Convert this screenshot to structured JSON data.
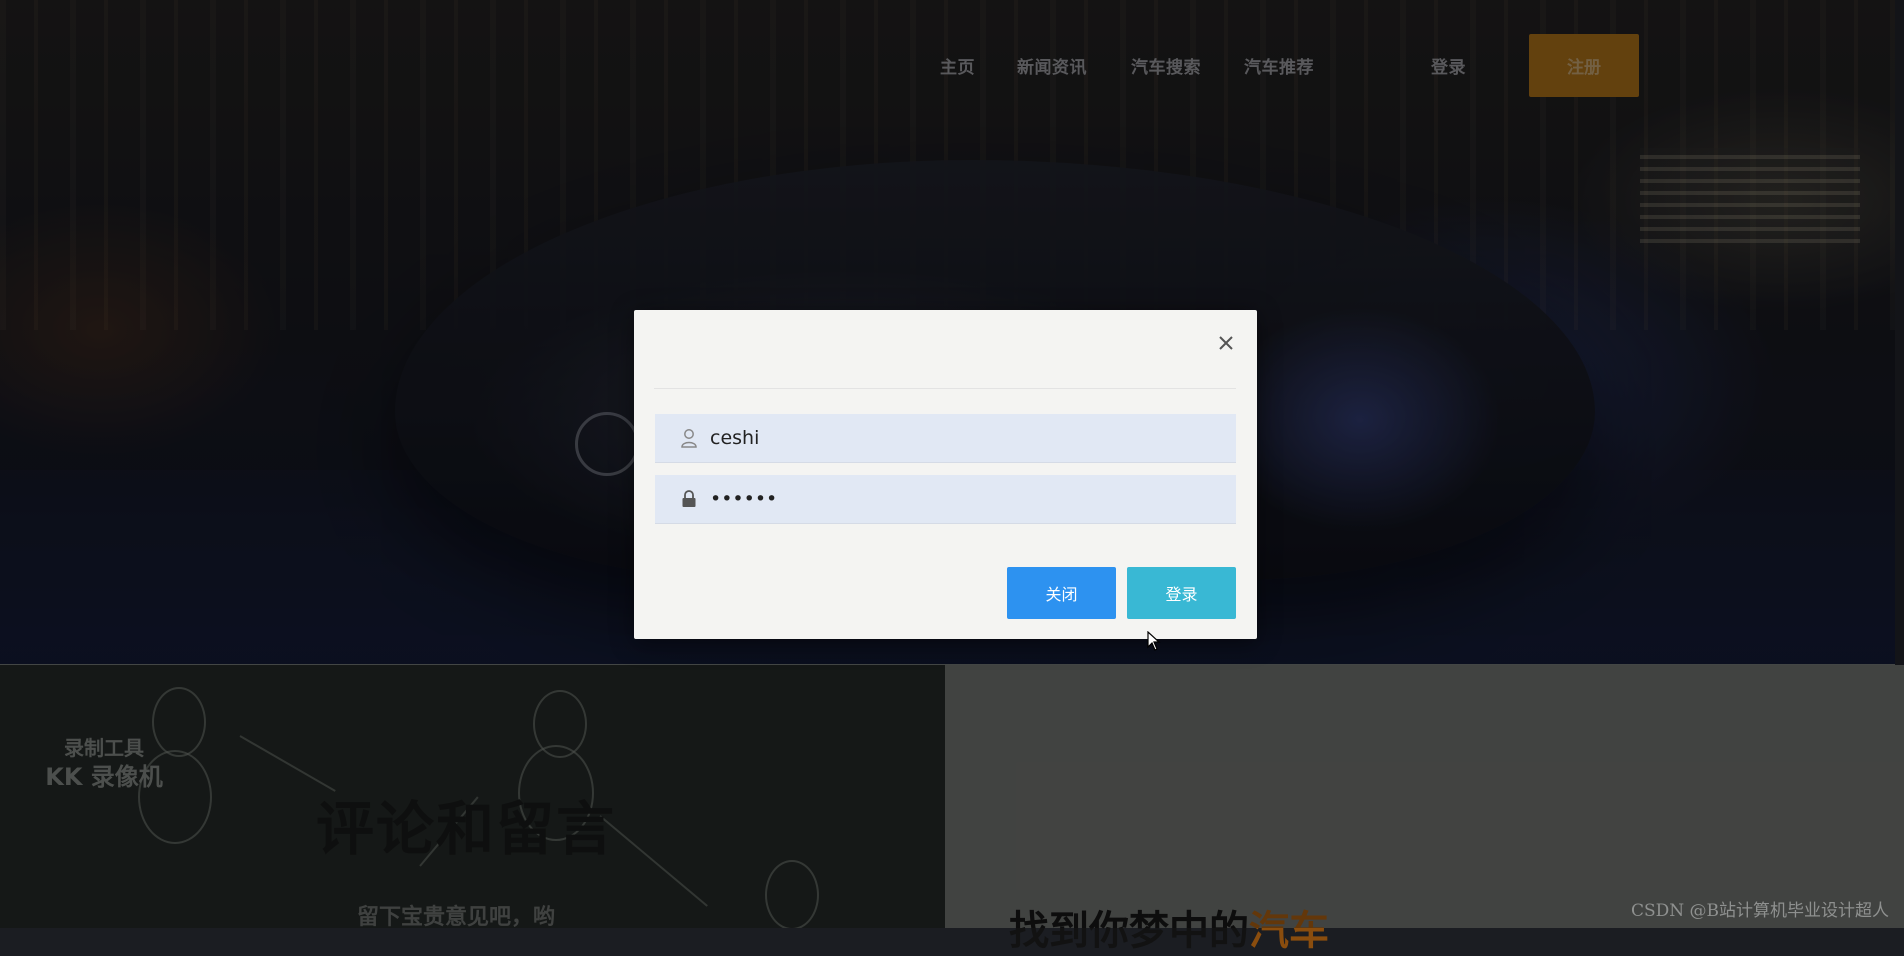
{
  "nav": {
    "items": [
      "主页",
      "新闻资讯",
      "汽车搜索",
      "汽车推荐"
    ],
    "login_label": "登录",
    "register_label": "注册"
  },
  "lower": {
    "recorder_line1": "录制工具",
    "recorder_line2": "KK 录像机",
    "comments_title": "评论和留言",
    "comments_subtitle": "留下宝贵意见吧，哟",
    "find_title_prefix": "找到你梦中的",
    "find_title_accent": "汽车",
    "watermark": "CSDN @B站计算机毕业设计超人"
  },
  "modal": {
    "username_value": "ceshi",
    "password_value": "123456",
    "close_button_label": "关闭",
    "login_button_label": "登录"
  },
  "colors": {
    "close_button": "#2d92f0",
    "login_button": "#39b8d4",
    "register_button": "#8a5a14",
    "accent_text": "#8a4d0e"
  },
  "icons": [
    "user-icon",
    "lock-icon",
    "close-icon",
    "mouse-cursor-icon"
  ]
}
